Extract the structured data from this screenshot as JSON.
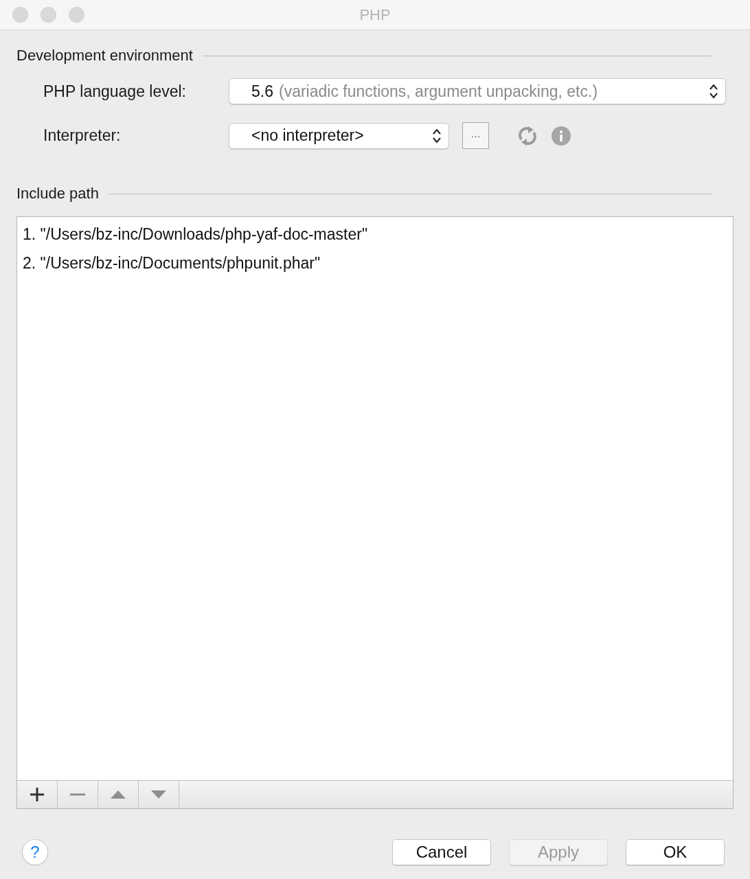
{
  "window": {
    "title": "PHP"
  },
  "development_environment": {
    "heading": "Development environment",
    "language_level": {
      "label": "PHP language level:",
      "value": "5.6",
      "hint": "(variadic functions, argument unpacking, etc.)"
    },
    "interpreter": {
      "label": "Interpreter:",
      "value": "<no interpreter>",
      "browse_button": "···"
    }
  },
  "include_path": {
    "heading": "Include path",
    "items": [
      {
        "number": "1.",
        "path": "\"/Users/bz-inc/Downloads/php-yaf-doc-master\""
      },
      {
        "number": "2.",
        "path": "\"/Users/bz-inc/Documents/phpunit.phar\""
      }
    ],
    "toolbar": [
      {
        "kind": "add",
        "disabled": false
      },
      {
        "kind": "remove",
        "disabled": true
      },
      {
        "kind": "up",
        "disabled": true
      },
      {
        "kind": "down",
        "disabled": true
      }
    ]
  },
  "help_button": "?",
  "buttons": [
    {
      "label": "Cancel",
      "disabled": false
    },
    {
      "label": "Apply",
      "disabled": true
    },
    {
      "label": "OK",
      "disabled": false
    }
  ]
}
